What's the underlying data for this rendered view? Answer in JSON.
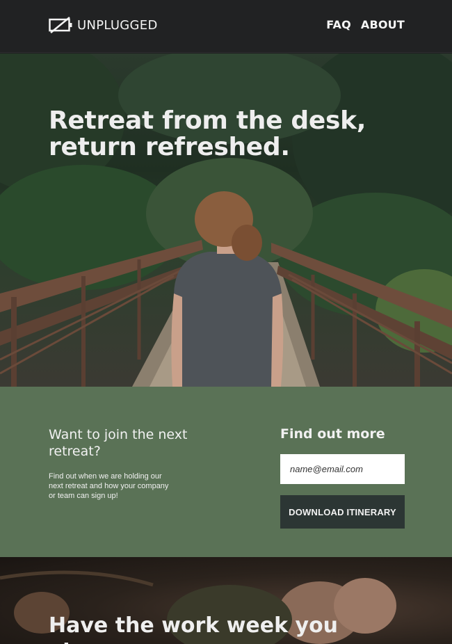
{
  "header": {
    "logo_text": "UNPLUGGED",
    "logo_icon": "unplugged-battery-icon",
    "nav": [
      "FAQ",
      "ABOUT"
    ]
  },
  "hero": {
    "title_line1": "Retreat from the desk,",
    "title_line2": "return refreshed."
  },
  "signup": {
    "join_title": "Want to join the next retreat?",
    "join_description": "Find out when we are holding our next retreat and how your company or team can sign up!",
    "more_title": "Find out more",
    "email_placeholder": "name@email.com",
    "download_label": "DOWNLOAD ITINERARY"
  },
  "bottom": {
    "title": "Have the work week you always"
  },
  "colors": {
    "header_bg": "#212223",
    "signup_bg": "#5a7256",
    "button_bg": "#2c3634"
  }
}
